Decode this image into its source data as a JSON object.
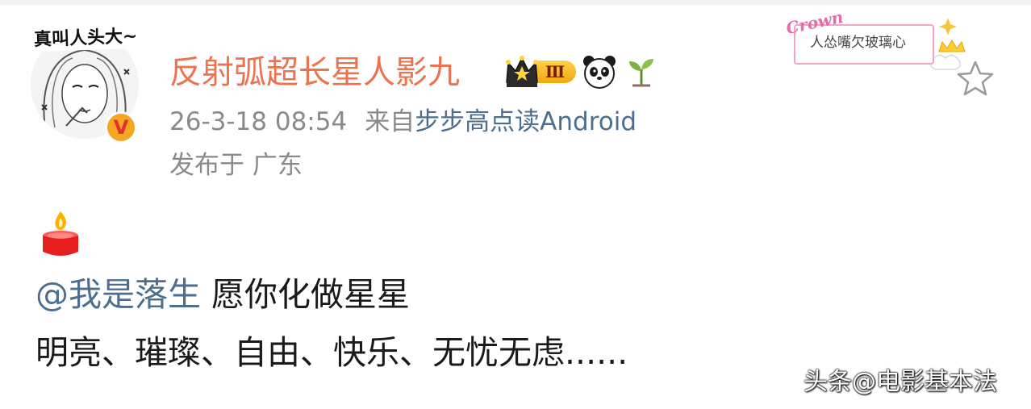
{
  "user": {
    "name": "反射弧超长星人影九",
    "avatar_caption": "真叫人头大~",
    "verified_mark": "V",
    "vip_level": "Ⅲ",
    "badge_icons": [
      "crown-icon",
      "panda-icon",
      "sprout-icon"
    ]
  },
  "meta": {
    "time": "26-3-18 08:54",
    "source_prefix": "来自",
    "source_name": "步步高点读Android",
    "location": "发布于 广东"
  },
  "sticker": {
    "label": "Crown",
    "text": "人怂嘴欠玻璃心"
  },
  "post": {
    "emoji": "candle-icon",
    "mention": "@我是落生",
    "line1_text": " 愿你化做星星",
    "line2": "明亮、璀璨、自由、快乐、无忧无虑......"
  },
  "watermark": "头条@电影基本法",
  "colors": {
    "username": "#eb7350",
    "link": "#4e6e8e",
    "meta": "#8a8a8a",
    "text": "#1a1a1a"
  }
}
